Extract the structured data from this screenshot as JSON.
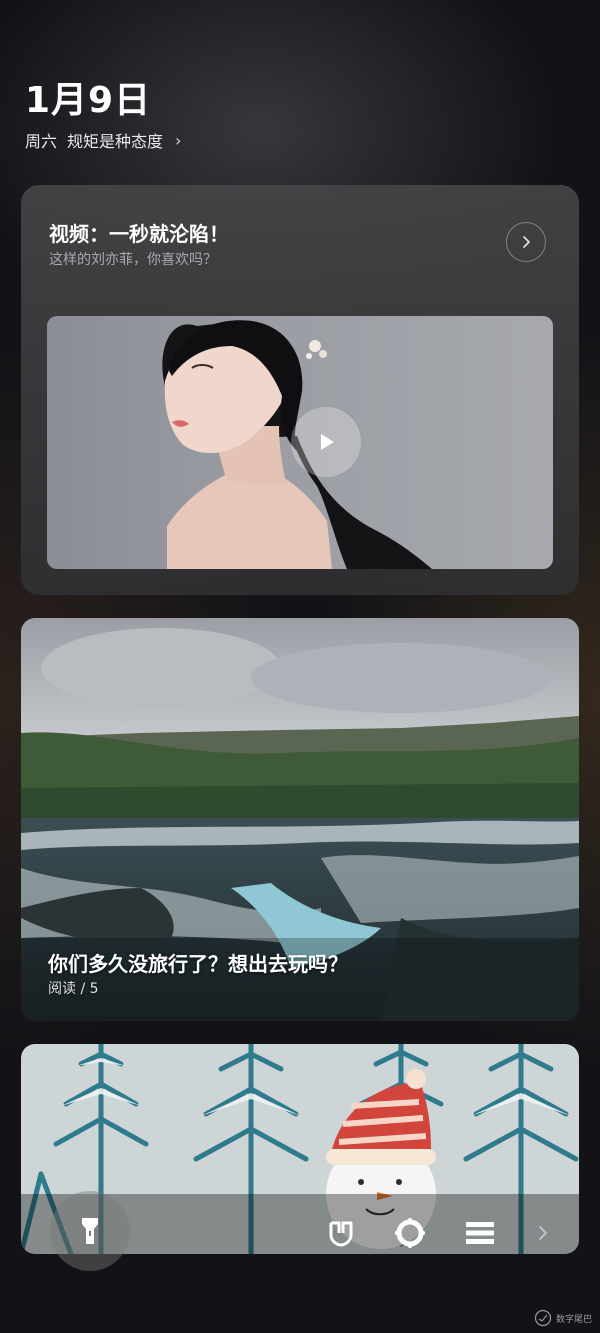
{
  "header": {
    "date": "1月9日",
    "weekday": "周六",
    "headline": "规矩是种态度",
    "chevron": "›"
  },
  "video_card": {
    "title": "视频：一秒就沦陷！",
    "subtitle": "这样的刘亦菲，你喜欢吗？",
    "next_icon": "chevron-right-icon",
    "play_icon": "play-icon"
  },
  "article_card": {
    "title": "你们多久没旅行了？想出去玩吗？",
    "meta": "阅读 / 5"
  },
  "dock": {
    "items": [
      "flashlight-icon",
      "mijia-icon",
      "lens-icon",
      "menu-icon",
      "chevron-right-icon"
    ]
  },
  "watermark": {
    "text": "数字尾巴"
  },
  "colors": {
    "background": "#131317",
    "card": "#3a3a3c",
    "subtext": "#a9a9ae"
  }
}
